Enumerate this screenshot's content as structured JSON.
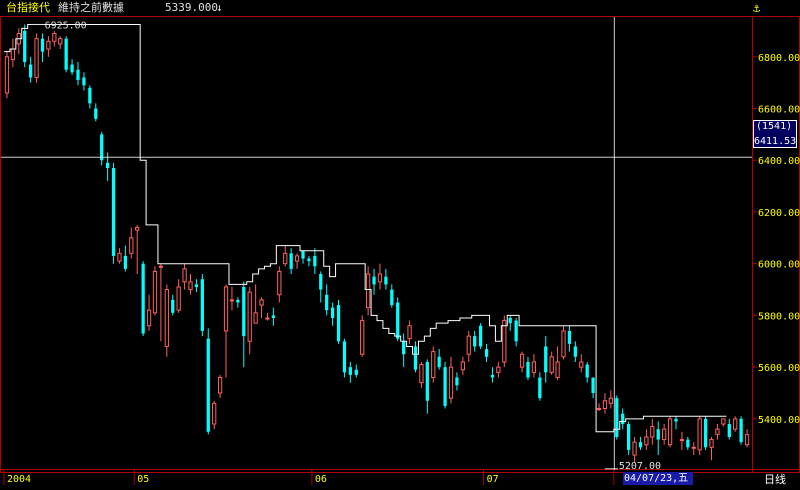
{
  "header": {
    "title": "台指接代",
    "indicator": "維持之前數據",
    "value": "5339.000",
    "arrow": "↓"
  },
  "icons": {
    "topright": "anchor-icon"
  },
  "colors": {
    "background": "#000000",
    "frame": "#b00000",
    "up": "#ff6060",
    "down": "#00ffff",
    "stop_line": "#ffffff",
    "axis_text": "#ffff00"
  },
  "crosshair": {
    "count_label": "(1541)",
    "y_value": "6411.53",
    "x_label": "04/07/23,五"
  },
  "period_label": "日线",
  "chart_data": {
    "type": "candlestick",
    "ylim": [
      5210,
      6950
    ],
    "y_ticks": [
      5400,
      5600,
      5800,
      6000,
      6200,
      6400,
      6600,
      6800
    ],
    "y_tick_labels": [
      "5400.00",
      "5600.00",
      "5800.00",
      "6000.00",
      "6200.00",
      "6400.00",
      "6600.00",
      "6800.00"
    ],
    "x_labels": [
      {
        "label": "2004",
        "index": 0
      },
      {
        "label": "05",
        "index": 22
      },
      {
        "label": "06",
        "index": 52
      },
      {
        "label": "07",
        "index": 81
      },
      {
        "label": "04/07/23,五",
        "index": 103
      }
    ],
    "annotations": [
      {
        "text": "6925.00",
        "index": 5,
        "y": 6925
      },
      {
        "text": "5207.00",
        "index": 102,
        "y": 5207
      }
    ],
    "candles": [
      [
        6660,
        6800,
        6640,
        6820
      ],
      [
        6790,
        6830,
        6760,
        6870
      ],
      [
        6850,
        6890,
        6810,
        6910
      ],
      [
        6900,
        6780,
        6760,
        6925
      ],
      [
        6770,
        6720,
        6700,
        6800
      ],
      [
        6720,
        6870,
        6700,
        6890
      ],
      [
        6870,
        6820,
        6780,
        6890
      ],
      [
        6830,
        6860,
        6800,
        6880
      ],
      [
        6860,
        6890,
        6840,
        6900
      ],
      [
        6850,
        6870,
        6830,
        6880
      ],
      [
        6870,
        6750,
        6740,
        6880
      ],
      [
        6770,
        6740,
        6730,
        6790
      ],
      [
        6750,
        6710,
        6690,
        6780
      ],
      [
        6720,
        6690,
        6670,
        6740
      ],
      [
        6680,
        6620,
        6600,
        6690
      ],
      [
        6600,
        6560,
        6550,
        6620
      ],
      [
        6500,
        6400,
        6380,
        6510
      ],
      [
        6390,
        6370,
        6320,
        6430
      ],
      [
        6370,
        6030,
        6000,
        6390
      ],
      [
        6010,
        6040,
        6000,
        6060
      ],
      [
        6030,
        5980,
        5970,
        6070
      ],
      [
        6040,
        6100,
        6020,
        6140
      ],
      [
        6130,
        6140,
        5960,
        6150
      ],
      [
        6000,
        5730,
        5720,
        6010
      ],
      [
        5760,
        5820,
        5740,
        5880
      ],
      [
        5810,
        5970,
        5800,
        5990
      ],
      [
        5990,
        5990,
        5700,
        6000
      ],
      [
        5680,
        5900,
        5640,
        5920
      ],
      [
        5860,
        5810,
        5800,
        5880
      ],
      [
        5820,
        5910,
        5810,
        5940
      ],
      [
        5930,
        5980,
        5900,
        6000
      ],
      [
        5900,
        5930,
        5880,
        5960
      ],
      [
        5920,
        5910,
        5890,
        5940
      ],
      [
        5940,
        5740,
        5720,
        5960
      ],
      [
        5710,
        5350,
        5340,
        5750
      ],
      [
        5380,
        5460,
        5360,
        5470
      ],
      [
        5500,
        5560,
        5480,
        5570
      ],
      [
        5740,
        5910,
        5560,
        5920
      ],
      [
        5860,
        5860,
        5820,
        5910
      ],
      [
        5860,
        5850,
        5830,
        5870
      ],
      [
        5910,
        5720,
        5600,
        5930
      ],
      [
        5700,
        5890,
        5650,
        5910
      ],
      [
        5770,
        5810,
        5770,
        5920
      ],
      [
        5840,
        5860,
        5790,
        5870
      ],
      [
        5790,
        5790,
        5780,
        5810
      ],
      [
        5800,
        5790,
        5760,
        5830
      ],
      [
        5880,
        5970,
        5850,
        5990
      ],
      [
        6000,
        6040,
        5990,
        6070
      ],
      [
        6040,
        5980,
        5960,
        6060
      ],
      [
        6010,
        6030,
        5980,
        6040
      ],
      [
        6050,
        6020,
        6000,
        6050
      ],
      [
        6020,
        6010,
        5990,
        6030
      ],
      [
        6030,
        5990,
        5960,
        6060
      ],
      [
        5960,
        5900,
        5850,
        5970
      ],
      [
        5880,
        5820,
        5800,
        5920
      ],
      [
        5830,
        5790,
        5760,
        5850
      ],
      [
        5840,
        5700,
        5690,
        5860
      ],
      [
        5700,
        5580,
        5560,
        5710
      ],
      [
        5600,
        5570,
        5540,
        5620
      ],
      [
        5590,
        5570,
        5560,
        5610
      ],
      [
        5650,
        5780,
        5640,
        5800
      ],
      [
        5830,
        5960,
        5800,
        5990
      ],
      [
        5950,
        5920,
        5880,
        5980
      ],
      [
        5930,
        5960,
        5900,
        6000
      ],
      [
        5950,
        5920,
        5900,
        5980
      ],
      [
        5900,
        5840,
        5830,
        5920
      ],
      [
        5850,
        5710,
        5700,
        5870
      ],
      [
        5700,
        5650,
        5600,
        5730
      ],
      [
        5710,
        5760,
        5690,
        5780
      ],
      [
        5680,
        5590,
        5580,
        5700
      ],
      [
        5540,
        5610,
        5520,
        5620
      ],
      [
        5620,
        5470,
        5420,
        5630
      ],
      [
        5560,
        5660,
        5540,
        5680
      ],
      [
        5640,
        5600,
        5590,
        5670
      ],
      [
        5600,
        5450,
        5440,
        5620
      ],
      [
        5480,
        5600,
        5460,
        5640
      ],
      [
        5560,
        5530,
        5510,
        5580
      ],
      [
        5590,
        5620,
        5570,
        5640
      ],
      [
        5650,
        5720,
        5620,
        5740
      ],
      [
        5720,
        5680,
        5660,
        5740
      ],
      [
        5760,
        5680,
        5670,
        5770
      ],
      [
        5670,
        5640,
        5620,
        5690
      ],
      [
        5570,
        5560,
        5540,
        5600
      ],
      [
        5580,
        5600,
        5560,
        5620
      ],
      [
        5620,
        5780,
        5600,
        5800
      ],
      [
        5790,
        5770,
        5740,
        5800
      ],
      [
        5780,
        5700,
        5680,
        5790
      ],
      [
        5600,
        5650,
        5580,
        5660
      ],
      [
        5620,
        5560,
        5550,
        5640
      ],
      [
        5580,
        5620,
        5560,
        5650
      ],
      [
        5560,
        5480,
        5470,
        5580
      ],
      [
        5680,
        5580,
        5540,
        5720
      ],
      [
        5580,
        5640,
        5570,
        5660
      ],
      [
        5560,
        5620,
        5550,
        5680
      ],
      [
        5640,
        5740,
        5630,
        5760
      ],
      [
        5740,
        5690,
        5660,
        5760
      ],
      [
        5680,
        5640,
        5620,
        5700
      ],
      [
        5600,
        5620,
        5580,
        5650
      ],
      [
        5610,
        5560,
        5540,
        5620
      ],
      [
        5560,
        5500,
        5480,
        5560
      ],
      [
        5440,
        5440,
        5430,
        5460
      ],
      [
        5440,
        5470,
        5420,
        5500
      ],
      [
        5460,
        5480,
        5440,
        5510
      ],
      [
        5480,
        5330,
        5320,
        5490
      ],
      [
        5420,
        5380,
        5360,
        5440
      ],
      [
        5380,
        5280,
        5260,
        5390
      ],
      [
        5260,
        5310,
        5230,
        5330
      ],
      [
        5310,
        5290,
        5280,
        5330
      ],
      [
        5300,
        5330,
        5280,
        5360
      ],
      [
        5330,
        5370,
        5300,
        5400
      ],
      [
        5360,
        5320,
        5260,
        5390
      ],
      [
        5320,
        5360,
        5300,
        5380
      ],
      [
        5300,
        5400,
        5290,
        5410
      ],
      [
        5400,
        5390,
        5360,
        5410
      ],
      [
        5320,
        5320,
        5280,
        5350
      ],
      [
        5320,
        5290,
        5280,
        5330
      ],
      [
        5290,
        5290,
        5260,
        5310
      ],
      [
        5280,
        5400,
        5260,
        5410
      ],
      [
        5400,
        5290,
        5280,
        5410
      ],
      [
        5290,
        5320,
        5240,
        5330
      ],
      [
        5340,
        5360,
        5320,
        5380
      ],
      [
        5380,
        5400,
        5370,
        5400
      ],
      [
        5380,
        5330,
        5320,
        5400
      ],
      [
        5360,
        5400,
        5350,
        5410
      ],
      [
        5400,
        5310,
        5300,
        5410
      ],
      [
        5300,
        5339,
        5290,
        5360
      ]
    ],
    "stop_line": [
      [
        0,
        6820
      ],
      [
        1,
        6830
      ],
      [
        2,
        6870
      ],
      [
        3,
        6910
      ],
      [
        4,
        6925
      ],
      [
        5,
        6925
      ],
      [
        6,
        6925
      ],
      [
        7,
        6925
      ],
      [
        8,
        6925
      ],
      [
        9,
        6925
      ],
      [
        10,
        6925
      ],
      [
        11,
        6925
      ],
      [
        12,
        6925
      ],
      [
        13,
        6925
      ],
      [
        14,
        6925
      ],
      [
        15,
        6925
      ],
      [
        16,
        6925
      ],
      [
        17,
        6925
      ],
      [
        18,
        6925
      ],
      [
        19,
        6925
      ],
      [
        20,
        6925
      ],
      [
        21,
        6925
      ],
      [
        22,
        6925
      ],
      [
        23,
        6400
      ],
      [
        24,
        6150
      ],
      [
        25,
        6150
      ],
      [
        26,
        6000
      ],
      [
        27,
        6000
      ],
      [
        28,
        6000
      ],
      [
        29,
        6000
      ],
      [
        30,
        6000
      ],
      [
        31,
        6000
      ],
      [
        32,
        6000
      ],
      [
        33,
        6000
      ],
      [
        34,
        6000
      ],
      [
        35,
        6000
      ],
      [
        36,
        6000
      ],
      [
        37,
        6000
      ],
      [
        38,
        5920
      ],
      [
        39,
        5920
      ],
      [
        40,
        5920
      ],
      [
        41,
        5930
      ],
      [
        42,
        5960
      ],
      [
        43,
        5980
      ],
      [
        44,
        5990
      ],
      [
        45,
        6000
      ],
      [
        46,
        6070
      ],
      [
        47,
        6070
      ],
      [
        48,
        6070
      ],
      [
        49,
        6070
      ],
      [
        50,
        6050
      ],
      [
        51,
        6050
      ],
      [
        52,
        6050
      ],
      [
        53,
        6050
      ],
      [
        54,
        5990
      ],
      [
        55,
        5950
      ],
      [
        56,
        6000
      ],
      [
        57,
        6000
      ],
      [
        58,
        6000
      ],
      [
        59,
        6000
      ],
      [
        60,
        6000
      ],
      [
        61,
        5900
      ],
      [
        62,
        5800
      ],
      [
        63,
        5780
      ],
      [
        64,
        5750
      ],
      [
        65,
        5730
      ],
      [
        66,
        5720
      ],
      [
        67,
        5700
      ],
      [
        68,
        5680
      ],
      [
        69,
        5650
      ],
      [
        70,
        5700
      ],
      [
        71,
        5720
      ],
      [
        72,
        5750
      ],
      [
        73,
        5770
      ],
      [
        74,
        5770
      ],
      [
        75,
        5780
      ],
      [
        76,
        5780
      ],
      [
        77,
        5790
      ],
      [
        78,
        5790
      ],
      [
        79,
        5800
      ],
      [
        80,
        5800
      ],
      [
        81,
        5800
      ],
      [
        82,
        5760
      ],
      [
        83,
        5700
      ],
      [
        84,
        5760
      ],
      [
        85,
        5800
      ],
      [
        86,
        5800
      ],
      [
        87,
        5760
      ],
      [
        88,
        5760
      ],
      [
        89,
        5760
      ],
      [
        90,
        5760
      ],
      [
        91,
        5760
      ],
      [
        92,
        5760
      ],
      [
        93,
        5760
      ],
      [
        94,
        5760
      ],
      [
        95,
        5760
      ],
      [
        96,
        5760
      ],
      [
        97,
        5760
      ],
      [
        98,
        5760
      ],
      [
        99,
        5760
      ],
      [
        100,
        5350
      ],
      [
        101,
        5350
      ],
      [
        102,
        5350
      ],
      [
        103,
        5360
      ],
      [
        104,
        5390
      ],
      [
        105,
        5400
      ],
      [
        106,
        5400
      ],
      [
        107,
        5400
      ],
      [
        108,
        5410
      ],
      [
        109,
        5410
      ],
      [
        110,
        5410
      ],
      [
        111,
        5410
      ],
      [
        112,
        5410
      ],
      [
        113,
        5410
      ],
      [
        114,
        5410
      ],
      [
        115,
        5410
      ],
      [
        116,
        5410
      ],
      [
        117,
        5410
      ],
      [
        118,
        5410
      ],
      [
        119,
        5410
      ],
      [
        120,
        5410
      ],
      [
        121,
        5410
      ]
    ]
  }
}
